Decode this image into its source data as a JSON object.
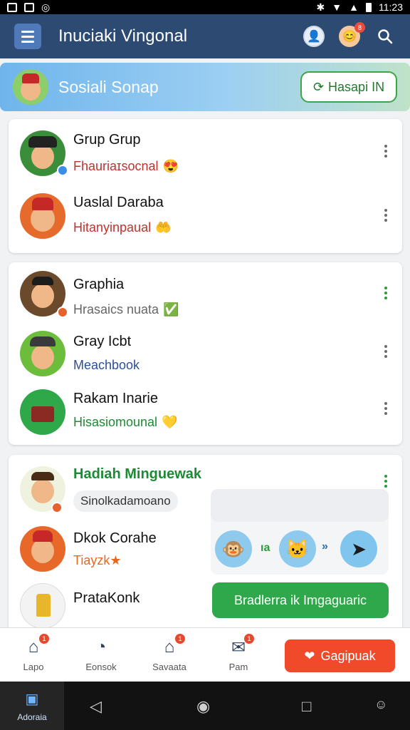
{
  "status_bar": {
    "time": "11:23"
  },
  "app_bar": {
    "title": "Inuciaki Vingonal",
    "notification_count": "8"
  },
  "banner": {
    "title": "Sosiali Sonap",
    "button_label": "Hasapi IN"
  },
  "card1": [
    {
      "name": "Grup Grup",
      "subtitle": "Fhauriaɪsocnal",
      "subtitle_color": "#c2322e",
      "emoji": "😍"
    },
    {
      "name": "Uaslal Daraba",
      "subtitle": "Hitanyinpaual",
      "subtitle_color": "#c2322e",
      "emoji": "🤲"
    }
  ],
  "card2": [
    {
      "name": "Graphia",
      "subtitle": "Hrasaics nuata",
      "subtitle_color": "#666666",
      "emoji": "✅"
    },
    {
      "name": "Gray Icbt",
      "subtitle": "Meachbook",
      "subtitle_color": "#2b4f9b",
      "emoji": ""
    },
    {
      "name": "Rakam Inarie",
      "subtitle": "Hisasiomounal",
      "subtitle_color": "#1d8a36",
      "emoji": "💛"
    }
  ],
  "card3": {
    "featured_name": "Hadiah Minguewak",
    "chip_label": "Sinolkadamoano",
    "row2_name": "Dkok Corahe",
    "row2_sub": "Tiayzk★",
    "row3_name": "PrataKonk",
    "popup_symbol_left": "ıa",
    "popup_symbol_mid": "»",
    "green_button": "Bradlerra ik Imgaguaric"
  },
  "bottom_nav": [
    {
      "label": "Lapo",
      "badge": "1"
    },
    {
      "label": "Eonsok",
      "badge": ""
    },
    {
      "label": "Savaata",
      "badge": "1"
    },
    {
      "label": "Pam",
      "badge": "1"
    }
  ],
  "bottom_action": {
    "label": "Gagipuak"
  },
  "system_bar": {
    "home_label": "Adoraia"
  },
  "colors": {
    "appbar": "#2c4a72",
    "accent_green": "#2ea84a",
    "accent_orange": "#f04a2a"
  }
}
